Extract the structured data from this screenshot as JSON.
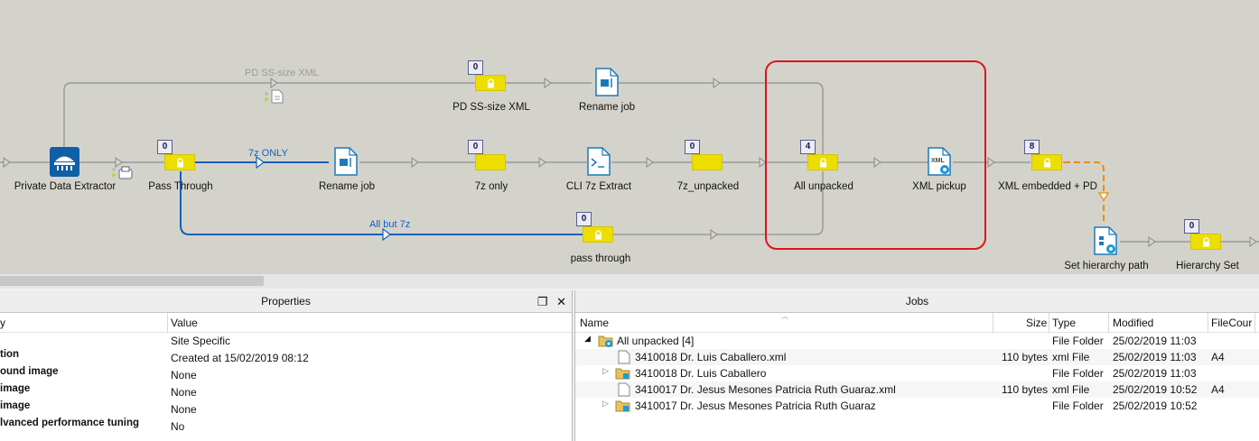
{
  "flow": {
    "nodes": {
      "private_data_extractor": "Private Data Extractor",
      "pass_through": "Pass Through",
      "rename_job_1": "Rename job",
      "sevenz_only": "7z only",
      "cli_7z_extract": "CLI 7z Extract",
      "sevenz_unpacked": "7z_unpacked",
      "all_unpacked": "All unpacked",
      "xml_pickup": "XML pickup",
      "xml_embedded_pd": "XML embedded + PD",
      "pd_ss_size_xml": "PD SS-size XML",
      "rename_job_2": "Rename job",
      "pass_through_lower": "pass through",
      "set_hierarchy_path": "Set hierarchy path",
      "hierarchy_set": "Hierarchy Set"
    },
    "badges": {
      "pass_through": "0",
      "sevenz_only": "0",
      "sevenz_unpacked": "0",
      "all_unpacked": "4",
      "xml_embedded_pd": "8",
      "pd_ss_size_xml": "0",
      "pass_through_lower": "0",
      "hierarchy_set": "0"
    },
    "connections": {
      "top_route": "PD SS-size XML",
      "sevenz_only_route": "7z ONLY",
      "all_but_7z_route": "All but 7z"
    },
    "xml_icon_text": "XML",
    "colors": {
      "canvas": "#d4d3cb",
      "folder": "#ecdf00",
      "connector_blue": "#1560bd",
      "connector_orange": "#f08a00",
      "highlight_red": "#e0141c"
    }
  },
  "properties": {
    "title": "Properties",
    "header": {
      "property": "y",
      "value": "Value"
    },
    "rows": [
      {
        "key": "",
        "value": "Site Specific"
      },
      {
        "key": "tion",
        "value": "Created at 15/02/2019 08:12"
      },
      {
        "key": "ound image",
        "value": "None"
      },
      {
        "key": "image",
        "value": "None"
      },
      {
        "key": "image",
        "value": "None"
      },
      {
        "key": "lvanced performance tuning",
        "value": "No"
      }
    ]
  },
  "jobs": {
    "title": "Jobs",
    "columns": {
      "name": "Name",
      "size": "Size",
      "type": "Type",
      "modified": "Modified",
      "filecour": "FileCour"
    },
    "rows": [
      {
        "name": "All unpacked [4]",
        "size": "",
        "type": "File Folder",
        "modified": "25/02/2019 11:03",
        "filecour": ""
      },
      {
        "name": "3410018 Dr. Luis Caballero.xml",
        "size": "110 bytes",
        "type": "xml File",
        "modified": "25/02/2019 11:03",
        "filecour": "A4"
      },
      {
        "name": "3410018 Dr. Luis Caballero",
        "size": "",
        "type": "File Folder",
        "modified": "25/02/2019 11:03",
        "filecour": ""
      },
      {
        "name": "3410017 Dr. Jesus Mesones Patricia Ruth Guaraz.xml",
        "size": "110 bytes",
        "type": "xml File",
        "modified": "25/02/2019 10:52",
        "filecour": "A4"
      },
      {
        "name": "3410017 Dr. Jesus Mesones Patricia Ruth Guaraz",
        "size": "",
        "type": "File Folder",
        "modified": "25/02/2019 10:52",
        "filecour": ""
      }
    ]
  }
}
